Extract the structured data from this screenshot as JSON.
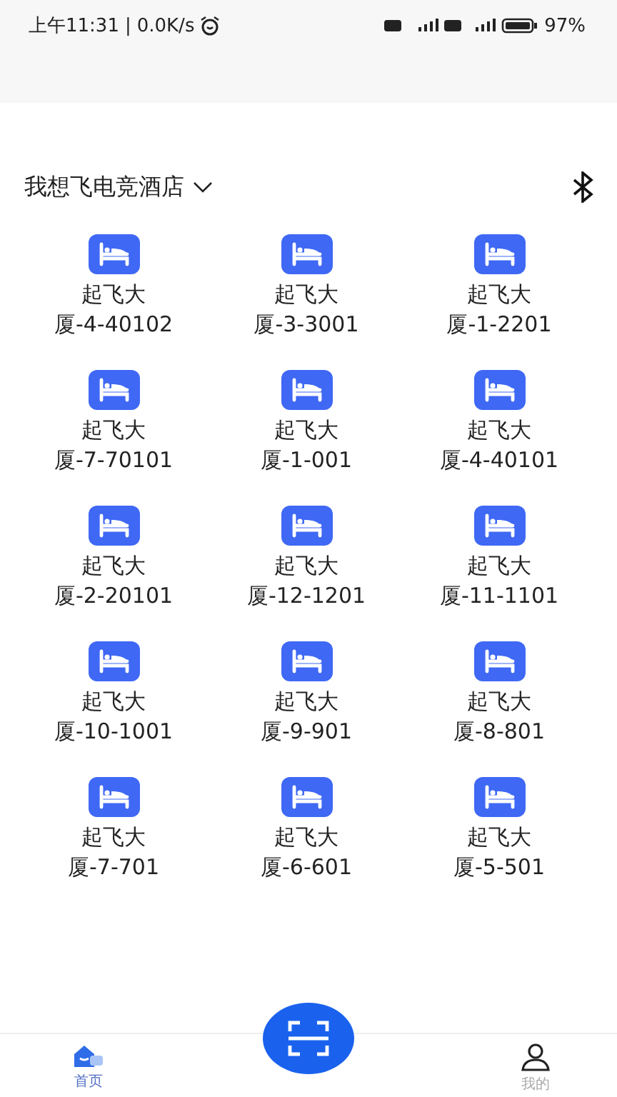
{
  "status_bar": {
    "time": "上午11:31",
    "divider": "|",
    "speed": "0.0K/s",
    "battery": "97%"
  },
  "header": {
    "hotel": "我想飞电竞酒店"
  },
  "rooms": [
    {
      "lines": [
        "起飞大",
        "厦-4-40102"
      ]
    },
    {
      "lines": [
        "起飞大",
        "厦-3-3001"
      ]
    },
    {
      "lines": [
        "起飞大",
        "厦-1-2201"
      ]
    },
    {
      "lines": [
        "起飞大",
        "厦-7-70101"
      ]
    },
    {
      "lines": [
        "起飞大",
        "厦-1-001"
      ]
    },
    {
      "lines": [
        "起飞大",
        "厦-4-40101"
      ]
    },
    {
      "lines": [
        "起飞大",
        "厦-2-20101"
      ]
    },
    {
      "lines": [
        "起飞大",
        "厦-12-1201"
      ]
    },
    {
      "lines": [
        "起飞大",
        "厦-11-1101"
      ]
    },
    {
      "lines": [
        "起飞大",
        "厦-10-1001"
      ]
    },
    {
      "lines": [
        "起飞大",
        "厦-9-901"
      ]
    },
    {
      "lines": [
        "起飞大",
        "厦-8-801"
      ]
    },
    {
      "lines": [
        "起飞大",
        "厦-7-701"
      ]
    },
    {
      "lines": [
        "起飞大",
        "厦-6-601"
      ]
    },
    {
      "lines": [
        "起飞大",
        "厦-5-501"
      ]
    }
  ],
  "tab_bar": [
    {
      "kind": "home",
      "label": "首页",
      "selected": true
    },
    {
      "kind": "scan"
    },
    {
      "kind": "profile",
      "label": "我的",
      "selected": false
    }
  ]
}
